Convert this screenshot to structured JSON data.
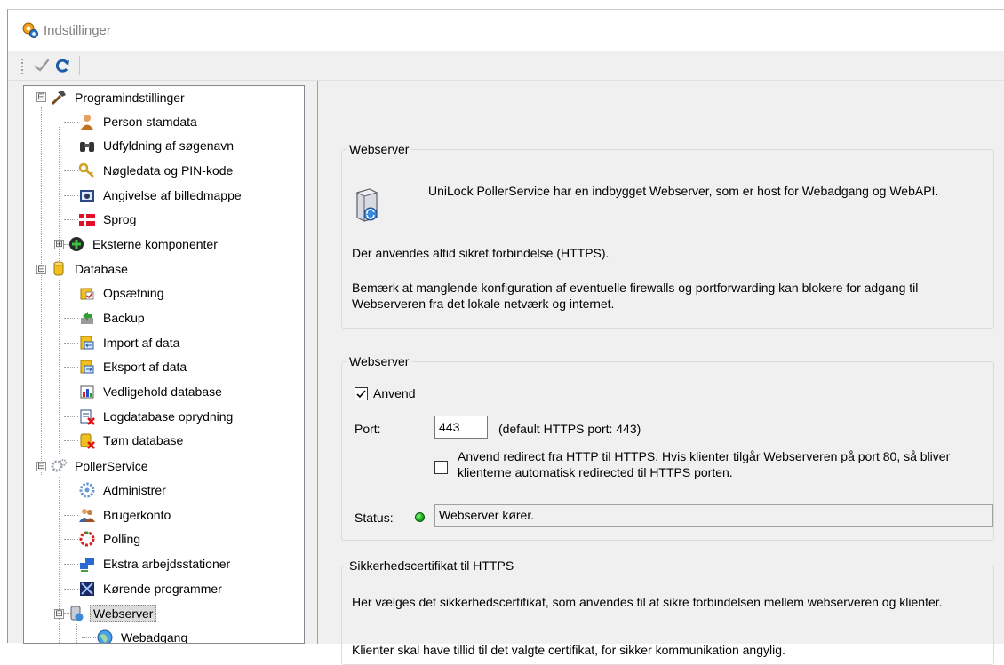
{
  "window": {
    "title": "Indstillinger"
  },
  "toolbar": {
    "apply_icon": "check-icon",
    "refresh_icon": "refresh-icon"
  },
  "tree": {
    "items": [
      {
        "label": "Programindstillinger",
        "icon": "hammer-icon",
        "expander": "⊟"
      },
      {
        "label": "Person stamdata",
        "icon": "person-icon"
      },
      {
        "label": "Udfyldning af søgenavn",
        "icon": "binoculars-icon"
      },
      {
        "label": "Nøgledata og PIN-kode",
        "icon": "key-icon"
      },
      {
        "label": "Angivelse af billedmappe",
        "icon": "picture-folder-icon"
      },
      {
        "label": "Sprog",
        "icon": "flag-icon"
      },
      {
        "label": "Eksterne komponenter",
        "icon": "components-icon",
        "expander": "⊞"
      },
      {
        "label": "Database",
        "icon": "database-icon",
        "expander": "⊟"
      },
      {
        "label": "Opsætning",
        "icon": "setup-icon"
      },
      {
        "label": "Backup",
        "icon": "backup-icon"
      },
      {
        "label": "Import af data",
        "icon": "import-icon"
      },
      {
        "label": "Eksport af data",
        "icon": "export-icon"
      },
      {
        "label": "Vedligehold database",
        "icon": "maintenance-icon"
      },
      {
        "label": "Logdatabase oprydning",
        "icon": "log-cleanup-icon"
      },
      {
        "label": "Tøm database",
        "icon": "empty-database-icon"
      },
      {
        "label": "PollerService",
        "icon": "gears-icon",
        "expander": "⊟"
      },
      {
        "label": "Administrer",
        "icon": "admin-icon"
      },
      {
        "label": "Brugerkonto",
        "icon": "users-icon"
      },
      {
        "label": "Polling",
        "icon": "polling-icon"
      },
      {
        "label": "Ekstra arbejdsstationer",
        "icon": "workstation-icon"
      },
      {
        "label": "Kørende programmer",
        "icon": "running-programs-icon"
      },
      {
        "label": "Webserver",
        "icon": "webserver-icon",
        "expander": "⊟"
      },
      {
        "label": "Webadgang",
        "icon": "globe-icon"
      }
    ],
    "selected": "Webserver"
  },
  "webserver_info": {
    "legend": "Webserver",
    "description": "UniLock PollerService har en indbygget Webserver, som er host for Webadgang og WebAPI.",
    "https_note": "Der anvendes altid sikret forbindelse (HTTPS).",
    "firewall_note": "Bemærk at manglende konfiguration af eventuelle firewalls og portforwarding kan blokere for adgang til Webserveren fra det lokale netværk og internet."
  },
  "webserver_settings": {
    "legend": "Webserver",
    "use_label": "Anvend",
    "use_checked": true,
    "port_label": "Port:",
    "port_value": "443",
    "port_hint": "(default HTTPS port: 443)",
    "redirect_label": "Anvend redirect fra HTTP til HTTPS. Hvis klienter tilgår Webserveren på port 80, så bliver klienterne automatisk redirected til HTTPS porten.",
    "redirect_checked": false,
    "status_label": "Status:",
    "status_value": "Webserver kører.",
    "status_color": "#12a812"
  },
  "certificate": {
    "legend": "Sikkerhedscertifikat til HTTPS",
    "description": "Her vælges det sikkerhedscertifikat, som anvendes til at sikre forbindelsen mellem webserveren og klienter.",
    "trust_note": "Klienter skal have tillid til det valgte certifikat, for sikker kommunikation angylig."
  }
}
